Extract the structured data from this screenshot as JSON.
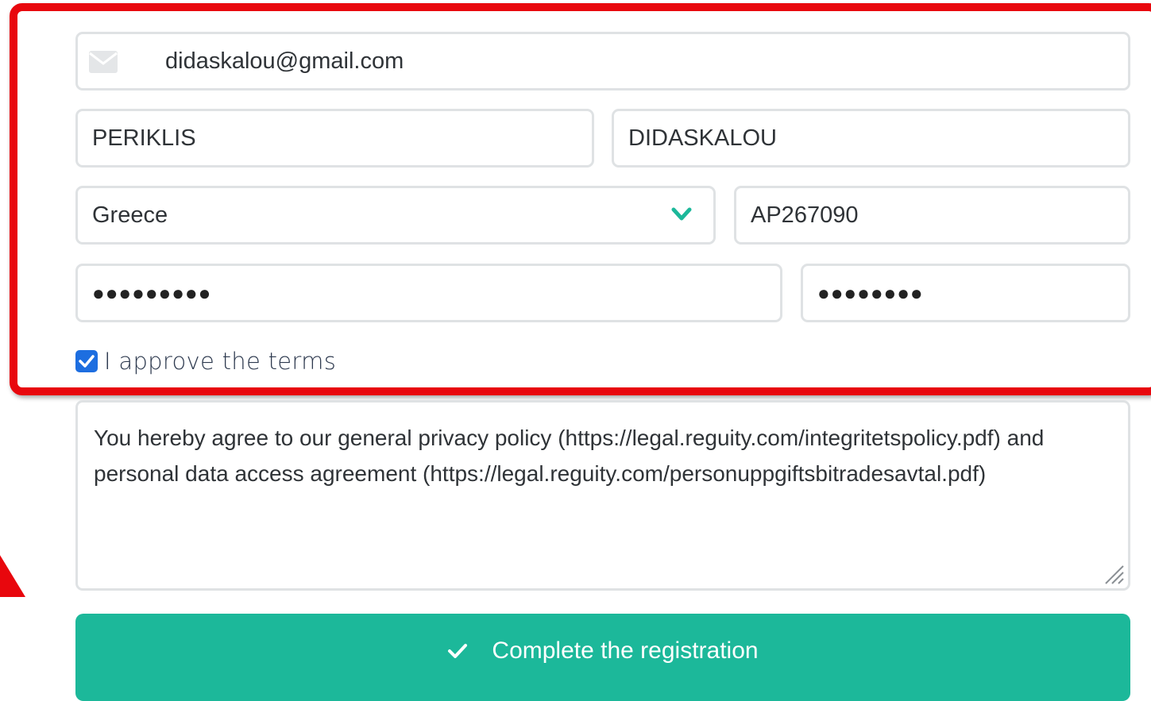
{
  "form": {
    "email": {
      "value": "didaskalou@gmail.com",
      "icon": "mail-icon"
    },
    "first_name": {
      "value": "PERIKLIS"
    },
    "last_name": {
      "value": "DIDASKALOU"
    },
    "country": {
      "selected": "Greece",
      "icon": "chevron-down-icon"
    },
    "passport": {
      "value": "AP267090"
    },
    "password": {
      "masked": "●●●●●●●●●"
    },
    "password_confirm": {
      "masked": "●●●●●●●●"
    },
    "terms": {
      "label": "I approve the terms",
      "checked": true
    },
    "policy_text": "You hereby agree to our general privacy policy (https://legal.reguity.com/integritetspolicy.pdf) and personal data access agreement (https://legal.reguity.com/personuppgiftsbitradesavtal.pdf)",
    "submit": {
      "label": "Complete the registration",
      "icon": "check-icon"
    }
  },
  "colors": {
    "highlight": "#e8070d",
    "accent": "#1cb89a",
    "checkbox": "#1d6ee0",
    "field_border": "#dfe2e4"
  }
}
